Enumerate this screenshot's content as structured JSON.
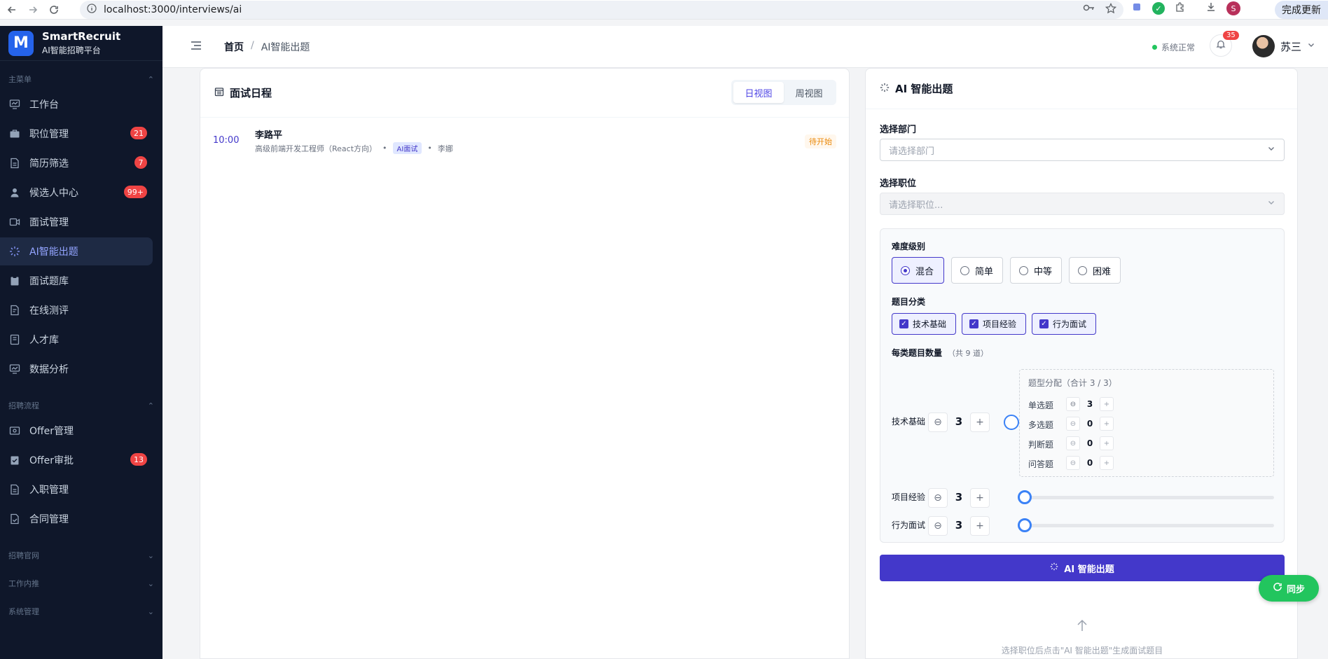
{
  "browser": {
    "url": "localhost:3000/interviews/ai",
    "update_label": "完成更新",
    "profile_initial": "S"
  },
  "brand": {
    "name": "SmartRecruit",
    "subtitle": "AI智能招聘平台",
    "logo_letter": "M"
  },
  "sidebar": {
    "sections": {
      "main": "主菜单",
      "flow": "招聘流程",
      "site": "招聘官网",
      "referral": "工作内推",
      "system": "系统管理"
    },
    "main_items": [
      {
        "label": "工作台",
        "icon": "dashboard-icon"
      },
      {
        "label": "职位管理",
        "icon": "briefcase-icon",
        "badge": "21"
      },
      {
        "label": "简历筛选",
        "icon": "document-icon",
        "badge": "7"
      },
      {
        "label": "候选人中心",
        "icon": "user-icon",
        "badge": "99+"
      },
      {
        "label": "面试管理",
        "icon": "video-icon"
      },
      {
        "label": "AI智能出题",
        "icon": "sparkle-icon",
        "active": true
      },
      {
        "label": "面试题库",
        "icon": "clipboard-icon"
      },
      {
        "label": "在线测评",
        "icon": "test-icon"
      },
      {
        "label": "人才库",
        "icon": "book-icon"
      },
      {
        "label": "数据分析",
        "icon": "chart-icon"
      }
    ],
    "flow_items": [
      {
        "label": "Offer管理",
        "icon": "offer-icon"
      },
      {
        "label": "Offer审批",
        "icon": "approval-icon",
        "badge": "13"
      },
      {
        "label": "入职管理",
        "icon": "onboard-icon"
      },
      {
        "label": "合同管理",
        "icon": "contract-icon"
      }
    ]
  },
  "header": {
    "breadcrumb_home": "首页",
    "breadcrumb_sep": "/",
    "breadcrumb_current": "AI智能出题",
    "status": "系统正常",
    "notif_count": "35",
    "user_name": "苏三"
  },
  "schedule": {
    "title": "面试日程",
    "view_day": "日视图",
    "view_week": "周视图",
    "event": {
      "time": "10:00",
      "name": "李路平",
      "position": "高级前端开发工程师（React方向）",
      "dot": "•",
      "tag": "AI面试",
      "interviewer": "李娜",
      "status": "待开始"
    }
  },
  "ai": {
    "title": "AI 智能出题",
    "dept_label": "选择部门",
    "dept_placeholder": "请选择部门",
    "job_label": "选择职位",
    "job_placeholder": "请选择职位...",
    "difficulty_label": "难度级别",
    "difficulty_options": [
      "混合",
      "简单",
      "中等",
      "困难"
    ],
    "difficulty_selected": "混合",
    "category_label": "题目分类",
    "categories": [
      "技术基础",
      "项目经验",
      "行为面试"
    ],
    "count_label": "每类题目数量",
    "count_hint": "（共 9 道）",
    "rows": [
      {
        "label": "技术基础",
        "value": "3"
      },
      {
        "label": "项目经验",
        "value": "3"
      },
      {
        "label": "行为面试",
        "value": "3"
      }
    ],
    "distribution": {
      "title": "题型分配（合计 3 / 3）",
      "items": [
        {
          "label": "单选题",
          "value": "3"
        },
        {
          "label": "多选题",
          "value": "0"
        },
        {
          "label": "判断题",
          "value": "0"
        },
        {
          "label": "问答题",
          "value": "0"
        }
      ]
    },
    "generate_label": "AI 智能出题",
    "empty_text": "选择职位后点击\"AI 智能出题\"生成面试题目"
  },
  "sync_label": "同步"
}
